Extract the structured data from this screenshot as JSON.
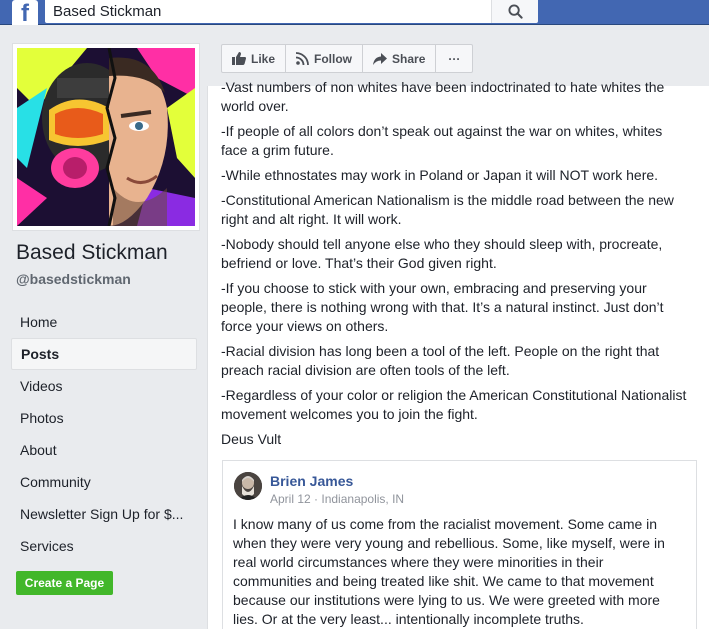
{
  "topbar": {
    "logo_letter": "f",
    "search_value": "Based Stickman",
    "search_icon": "search-icon"
  },
  "page": {
    "name": "Based Stickman",
    "handle": "@basedstickman"
  },
  "nav": {
    "items": [
      {
        "label": "Home"
      },
      {
        "label": "Posts"
      },
      {
        "label": "Videos"
      },
      {
        "label": "Photos"
      },
      {
        "label": "About"
      },
      {
        "label": "Community"
      },
      {
        "label": "Newsletter Sign Up for $..."
      },
      {
        "label": "Services"
      }
    ],
    "active": "Posts",
    "create_label": "Create a Page"
  },
  "actions": {
    "like": "Like",
    "follow": "Follow",
    "share": "Share",
    "more": "···"
  },
  "post": {
    "paragraphs": [
      "-Vast numbers of non whites have been indoctrinated to hate whites the world over.",
      "-If people of all colors don’t speak out against the war on whites, whites face a grim future.",
      "-While ethnostates may work in Poland or Japan it will NOT work here.",
      "-Constitutional American Nationalism is the middle road between the new right and alt right. It will work.",
      "-Nobody should tell anyone else who they should sleep with, procreate, befriend or love. That’s their God given right.",
      "-If you choose to stick with your own, embracing and preserving your people, there is nothing wrong with that. It’s a natural instinct. Just don’t force your views on others.",
      "-Racial division has long been a tool of the left. People on the right that preach racial division are often tools of the left.",
      "-Regardless of your color or religion the American Constitutional Nationalist movement welcomes you to join the fight.",
      "Deus Vult"
    ]
  },
  "shared": {
    "author": "Brien James",
    "date": "April 12",
    "separator": "·",
    "location": "Indianapolis, IN",
    "text": "I know many of us come from the racialist movement. Some came in when they were very young and rebellious. Some, like myself, were in real world circumstances where they were minorities in their communities and being treated like shit. We came to that movement because our institutions were lying to us. We were greeted with more lies. Or at the very least... intentionally incomplete truths."
  },
  "colors": {
    "brand": "#4267b2",
    "link": "#385898",
    "create_button": "#42b72a"
  }
}
